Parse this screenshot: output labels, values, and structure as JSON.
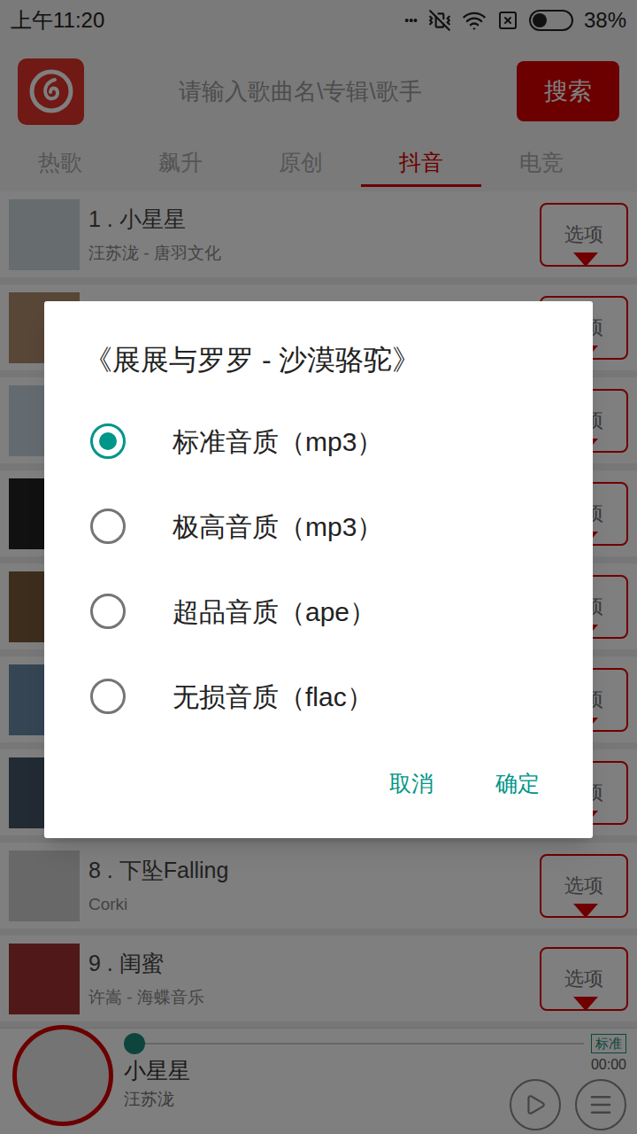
{
  "status_bar": {
    "dots": "•••",
    "time": "上午11:20",
    "battery": "38%",
    "battery_level": 0.38
  },
  "search": {
    "placeholder": "请输入歌曲名\\专辑\\歌手",
    "button": "搜索"
  },
  "tabs": [
    {
      "label": "热歌",
      "selected": false
    },
    {
      "label": "飙升",
      "selected": false
    },
    {
      "label": "原创",
      "selected": false
    },
    {
      "label": "抖音",
      "selected": true
    },
    {
      "label": "电竞",
      "selected": false
    }
  ],
  "songs": [
    {
      "title": "1 . 小星星",
      "artist": "汪苏泷 - 唐羽文化",
      "option": "选项"
    },
    {
      "option": "选项"
    },
    {
      "option": "选项"
    },
    {
      "option": "选项"
    },
    {
      "option": "选项"
    },
    {
      "option": "选项"
    },
    {
      "option": "选项"
    },
    {
      "title": "8 . 下坠Falling",
      "artist": "Corki",
      "option": "选项"
    },
    {
      "title": "9 . 闺蜜",
      "artist": "许嵩 - 海蝶音乐",
      "option": "选项"
    }
  ],
  "player": {
    "title": "小星星",
    "artist": "汪苏泷",
    "time": "00:00",
    "quality": "标准",
    "level": 0
  },
  "dialog": {
    "title": "《展展与罗罗 - 沙漠骆驼》",
    "options": [
      {
        "label": "标准音质（mp3）",
        "selected": true
      },
      {
        "label": "极高音质（mp3）",
        "selected": false
      },
      {
        "label": "超品音质（ape）",
        "selected": false
      },
      {
        "label": "无损音质（flac）",
        "selected": false
      }
    ],
    "buttons": [
      "取消",
      "确定"
    ]
  }
}
